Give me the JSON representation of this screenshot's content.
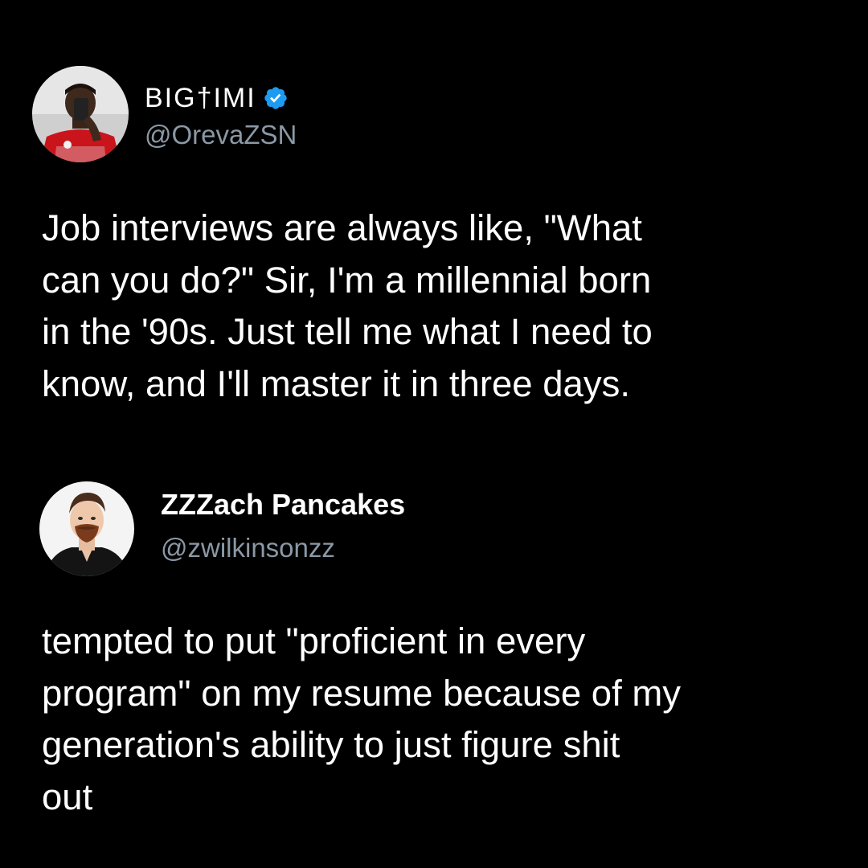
{
  "tweets": [
    {
      "display_name": "BIG†IMI",
      "verified": true,
      "handle": "@OrevaZSN",
      "text": "Job interviews are always like, \"What\ncan you do?\" Sir, I'm a millennial born\nin the '90s. Just tell me what I need to\nknow, and I'll master it in three days.",
      "avatar_icon": "selfie-avatar"
    },
    {
      "display_name": "ZZZach Pancakes",
      "verified": false,
      "handle": "@zwilkinsonzz",
      "text": "tempted to put \"proficient in every\nprogram\" on my resume because of my\ngeneration's ability to just figure shit\nout",
      "avatar_icon": "portrait-avatar"
    }
  ],
  "colors": {
    "background": "#000000",
    "text": "#ffffff",
    "handle": "#8b98a5",
    "verified": "#1d9bf0"
  }
}
